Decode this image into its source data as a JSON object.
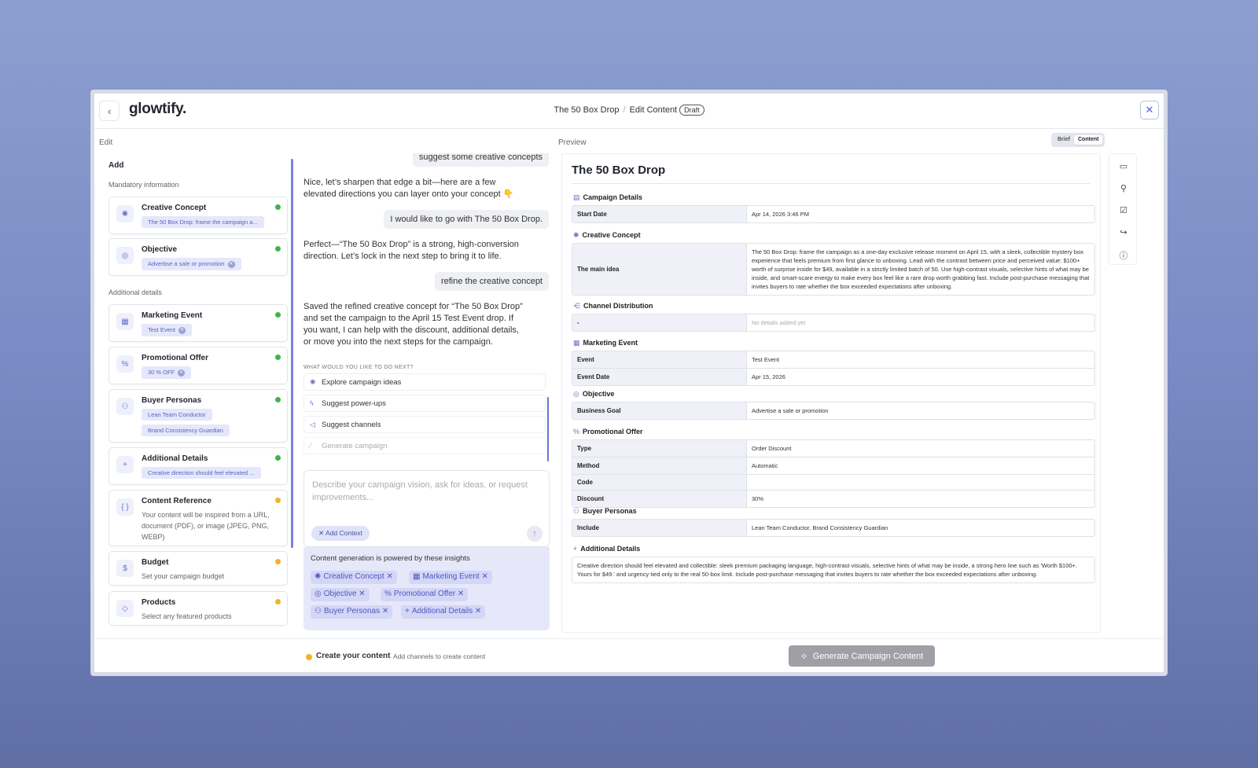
{
  "app": {
    "logo": "glowtify.",
    "back_icon": "chevron-left-icon",
    "close_icon": "close-icon"
  },
  "breadcrumb": {
    "campaign": "The 50 Box Drop",
    "separator": "/",
    "page": "Edit Content",
    "status": "Draft"
  },
  "sections": {
    "edit": "Edit",
    "preview": "Preview"
  },
  "left": {
    "add": "Add",
    "mandatory": "Mandatory information",
    "additional": "Additional details",
    "cards": [
      {
        "title": "Creative Concept",
        "chips": [
          "The 50 Box Drop: frame the campaign a..."
        ],
        "status": "complete",
        "icon": "lightbulb-icon"
      },
      {
        "title": "Objective",
        "chips": [
          "Advertise a sale or promotion"
        ],
        "status": "complete",
        "icon": "target-icon"
      },
      {
        "title": "Marketing Event",
        "chips": [
          "Test Event"
        ],
        "status": "complete",
        "icon": "calendar-icon"
      },
      {
        "title": "Promotional Offer",
        "chips": [
          "30 % OFF"
        ],
        "status": "complete",
        "icon": "percent-icon"
      },
      {
        "title": "Buyer Personas",
        "chips": [
          "Lean Team Conductor",
          "Brand Consistency Guardian"
        ],
        "status": "complete",
        "icon": "users-icon"
      },
      {
        "title": "Additional Details",
        "chips": [
          "Creative direction should feel elevated ..."
        ],
        "status": "complete",
        "icon": "plus-icon"
      },
      {
        "title": "Content Reference",
        "subtitle": "Your content will be inspired from a URL, document (PDF), or image (JPEG, PNG, WEBP)",
        "status": "pending",
        "icon": "braces-icon"
      },
      {
        "title": "Budget",
        "subtitle": "Set your campaign budget",
        "status": "pending",
        "icon": "dollar-icon"
      },
      {
        "title": "Products",
        "subtitle": "Select any featured products",
        "status": "pending",
        "icon": "tag-icon"
      }
    ],
    "status_colors": {
      "complete": "#3db54a",
      "pending": "#f0b429"
    }
  },
  "chat": {
    "messages": [
      {
        "role": "user",
        "text": "suggest some creative concepts"
      },
      {
        "role": "assistant",
        "text": "Nice, let’s sharpen that edge a bit—here are a few elevated directions you can layer onto your concept 👇"
      },
      {
        "role": "user",
        "text": "I would like to go with The 50 Box Drop."
      },
      {
        "role": "assistant",
        "text": "Perfect—“The 50 Box Drop” is a strong, high-conversion direction. Let’s lock in the next step to bring it to life."
      },
      {
        "role": "user",
        "text": "refine the creative concept"
      },
      {
        "role": "assistant",
        "text": "Saved the refined creative concept for “The 50 Box Drop” and set the campaign to the April 15 Test Event drop. If you want, I can help with the discount, additional details, or move you into the next steps for the campaign."
      }
    ],
    "next_heading": "WHAT WOULD YOU LIKE TO DO NEXT?",
    "options": [
      {
        "label": "Explore campaign ideas",
        "icon": "lightbulb-icon"
      },
      {
        "label": "Suggest power-ups",
        "icon": "bolt-icon"
      },
      {
        "label": "Suggest channels",
        "icon": "megaphone-icon"
      },
      {
        "label": "Generate campaign",
        "icon": "magic-wand-icon"
      }
    ],
    "input_placeholder": "Describe your campaign vision, ask for ideas, or request improvements...",
    "add_context": "Add Context",
    "send_icon": "arrow-up-icon",
    "insights_heading": "Content generation is powered by these insights",
    "insight_chips": [
      "Creative Concept",
      "Marketing Event",
      "Objective",
      "Promotional Offer",
      "Buyer Personas",
      "Additional Details"
    ]
  },
  "toggle": {
    "brief": "Brief",
    "content": "Content",
    "active": "content"
  },
  "preview": {
    "title": "The 50 Box Drop",
    "campaign_details": {
      "heading": "Campaign Details",
      "rows": [
        [
          "Start Date",
          "Apr 14, 2026 3:46 PM"
        ]
      ]
    },
    "creative_concept": {
      "heading": "Creative Concept",
      "rows": [
        [
          "The main idea",
          "The 50 Box Drop: frame the campaign as a one-day exclusive release moment on April 15, with a sleek, collectible mystery box experience that feels premium from first glance to unboxing. Lead with the contrast between price and perceived value: $100+ worth of surprise inside for $49, available in a strictly limited batch of 50. Use high-contrast visuals, selective hints of what may be inside, and smart-scare energy to make every box feel like a rare drop worth grabbing fast. Include post-purchase messaging that invites buyers to rate whether the box exceeded expectations after unboxing."
        ]
      ]
    },
    "channel_distribution": {
      "heading": "Channel Distribution",
      "rows": [
        [
          "-",
          "No details added yet"
        ]
      ]
    },
    "marketing_event": {
      "heading": "Marketing Event",
      "rows": [
        [
          "Event",
          "Test Event"
        ],
        [
          "Event Date",
          "Apr 15, 2026"
        ]
      ]
    },
    "objective": {
      "heading": "Objective",
      "rows": [
        [
          "Business Goal",
          "Advertise a sale or promotion"
        ]
      ]
    },
    "promotional_offer": {
      "heading": "Promotional Offer",
      "rows": [
        [
          "Type",
          "Order Discount"
        ],
        [
          "Method",
          "Automatic"
        ],
        [
          "Code",
          ""
        ],
        [
          "Discount",
          "30%"
        ]
      ]
    },
    "buyer_personas": {
      "heading": "Buyer Personas",
      "rows": [
        [
          "Include",
          "Lean Team Conductor, Brand Consistency Guardian"
        ]
      ]
    },
    "additional_details": {
      "heading": "Additional Details",
      "text": "Creative direction should feel elevated and collectible: sleek premium packaging language, high-contrast visuals, selective hints of what may be inside, a strong hero line such as 'Worth $100+. Yours for $49.' and urgency tied only to the real 50-box limit. Include post-purchase messaging that invites buyers to rate whether the box exceeded expectations after unboxing."
    }
  },
  "rail": [
    "comment-icon",
    "user-icon",
    "checkbox-icon",
    "share-icon",
    "info-icon"
  ],
  "footer": {
    "status": "Create your content",
    "hint": "Add channels to create content",
    "generate": "Generate Campaign Content",
    "generate_icon": "sparkle-icon"
  }
}
